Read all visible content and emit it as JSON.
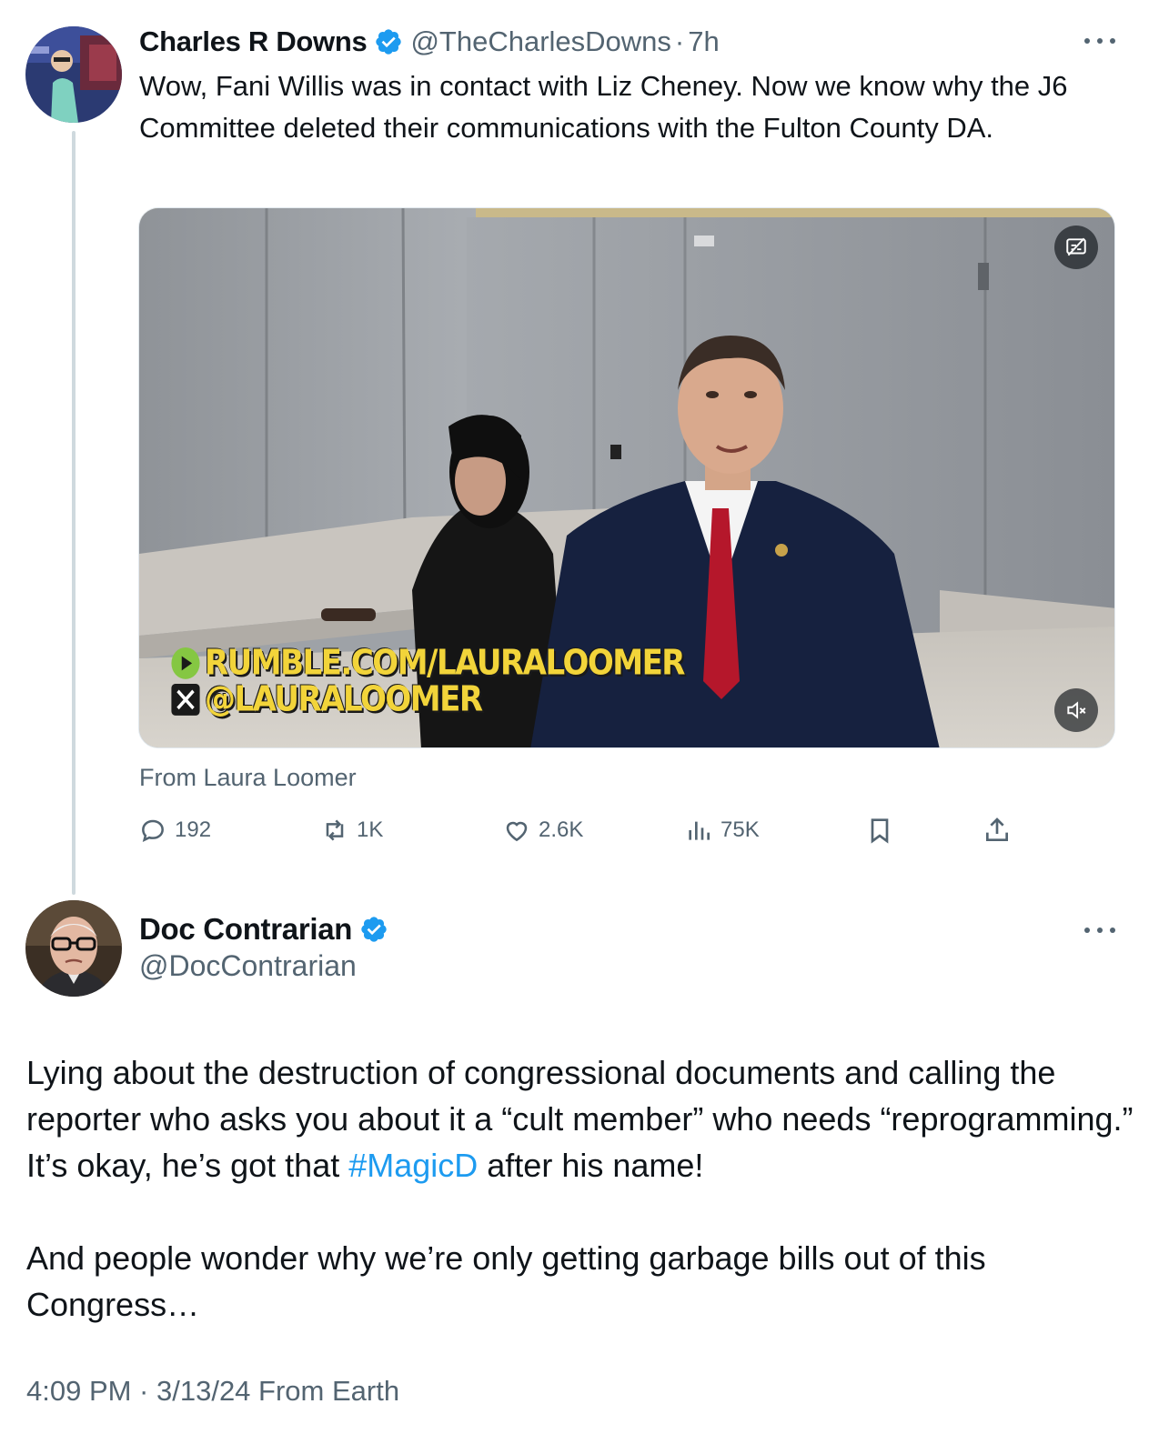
{
  "parent_tweet": {
    "author_name": "Charles R Downs",
    "handle": "@TheCharlesDowns",
    "separator": "·",
    "time": "7h",
    "text": "Wow, Fani Willis was in contact with Liz Cheney. Now we know why the J6 Committee deleted their communications with the Fulton County DA.",
    "media": {
      "watermark_line1": "RUMBLE.COM/LAURALOOMER",
      "watermark_line2": "@LAURALOOMER",
      "icons": [
        "sensitive-content-icon",
        "mute-icon",
        "rumble-icon",
        "x-logo-icon"
      ]
    },
    "attribution": "From Laura Loomer",
    "metrics": {
      "replies": "192",
      "reposts": "1K",
      "likes": "2.6K",
      "views": "75K"
    },
    "action_icons": [
      "reply-icon",
      "repost-icon",
      "like-icon",
      "views-icon",
      "bookmark-icon",
      "share-icon"
    ]
  },
  "reply_tweet": {
    "author_name": "Doc Contrarian",
    "handle": "@DocContrarian",
    "text_before_hashtag": "Lying about the destruction of congressional documents and calling the reporter who asks you about it a “cult member” who needs “reprogramming.” It’s okay, he’s got that ",
    "hashtag": "#MagicD",
    "text_after_hashtag": " after his name!",
    "paragraph2": "And people wonder why we’re only getting garbage bills out of this Congress…",
    "timestamp": "4:09 PM · 3/13/24 From Earth"
  },
  "colors": {
    "text": "#0f1419",
    "secondary": "#536471",
    "accent": "#1d9bf0",
    "thread_line": "#cfd9de",
    "watermark": "#f2d43a"
  }
}
